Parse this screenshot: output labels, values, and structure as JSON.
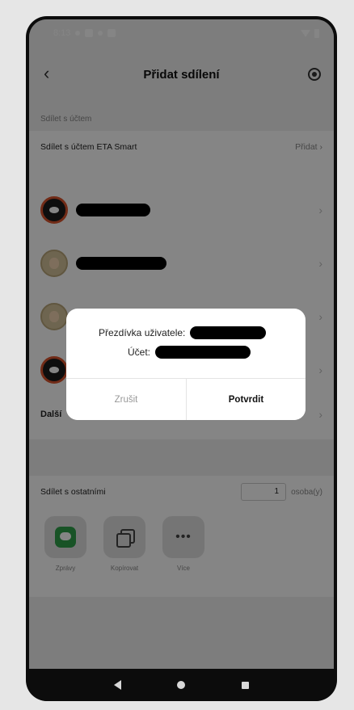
{
  "status_bar": {
    "time": "8:13"
  },
  "header": {
    "title": "Přidat sdílení",
    "back_icon": "chevron-left-icon",
    "settings_icon": "settings-icon"
  },
  "account_share": {
    "section_label": "Sdílet s účtem",
    "row_label": "Sdílet s účtem ETA Smart",
    "add_label": "Přidat"
  },
  "further_label": "Další",
  "share_others": {
    "label": "Sdílet s ostatními",
    "count": "1",
    "unit": "osoba(y)",
    "apps": [
      {
        "label": "Zprávy",
        "icon": "message-icon"
      },
      {
        "label": "Kopírovat",
        "icon": "copy-icon"
      },
      {
        "label": "Více",
        "icon": "more-icon"
      }
    ]
  },
  "dialog": {
    "nickname_label": "Přezdívka uživatele:",
    "account_label": "Účet:",
    "cancel_label": "Zrušit",
    "confirm_label": "Potvrdit"
  },
  "colors": {
    "overlay": "#000000",
    "message_app": "#2ea04a",
    "avatar_ring": "#d9542c"
  }
}
